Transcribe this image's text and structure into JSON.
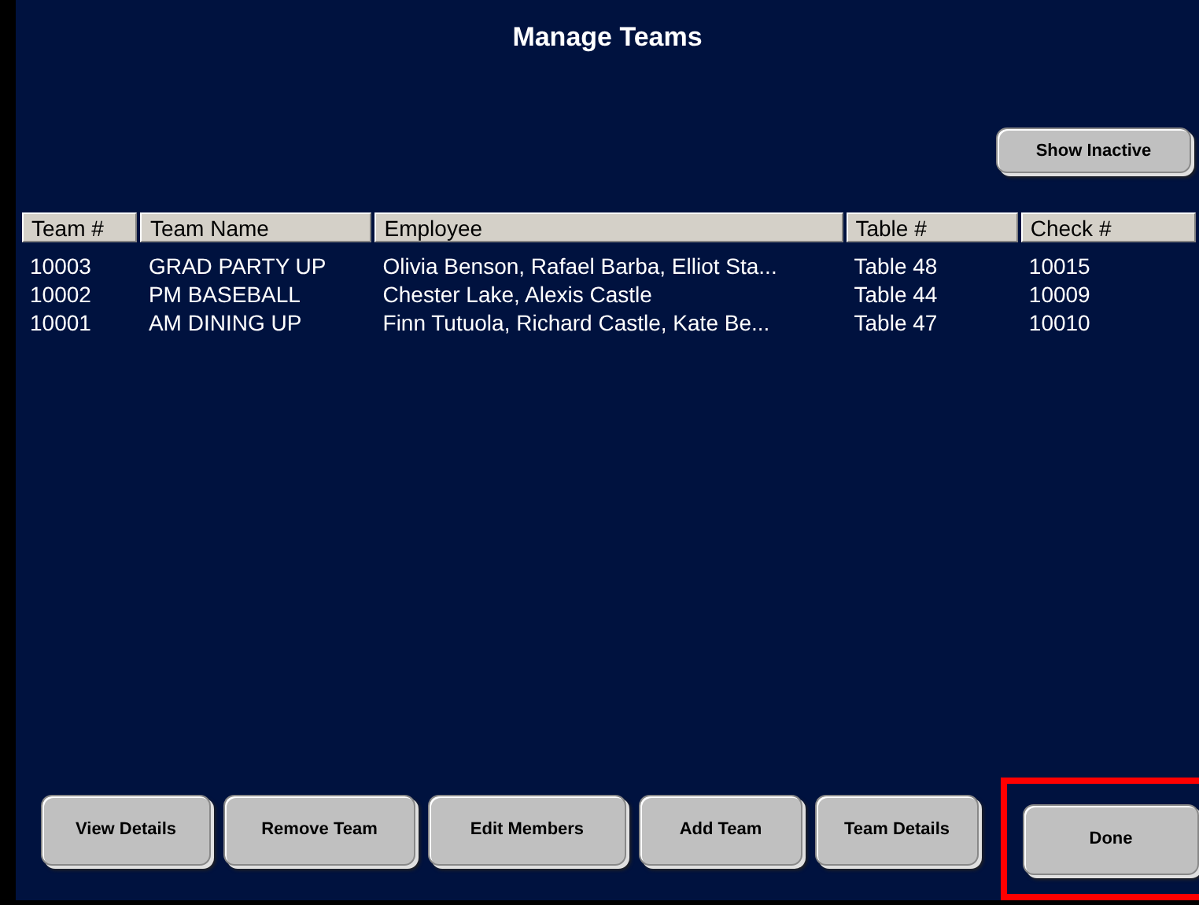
{
  "window": {
    "title": "Manage Teams"
  },
  "show_inactive_button": {
    "label": "Show Inactive"
  },
  "table": {
    "columns": [
      "Team #",
      "Team Name",
      "Employee",
      "Table #",
      "Check #"
    ],
    "rows": [
      [
        "10003",
        "GRAD PARTY UP",
        "Olivia Benson, Rafael Barba, Elliot Sta...",
        "Table 48",
        "10015"
      ],
      [
        "10002",
        "PM BASEBALL",
        "Chester Lake, Alexis Castle",
        "Table 44",
        "10009"
      ],
      [
        "10001",
        "AM DINING UP",
        "Finn Tutuola, Richard Castle, Kate Be...",
        "Table 47",
        "10010"
      ]
    ]
  },
  "buttons": [
    {
      "label": "View Details",
      "highlighted": false
    },
    {
      "label": "Remove Team",
      "highlighted": false
    },
    {
      "label": "Edit Members",
      "highlighted": false
    },
    {
      "label": "Add Team",
      "highlighted": false
    },
    {
      "label": "Team Details",
      "highlighted": false
    },
    {
      "label": "Done",
      "highlighted": true
    }
  ]
}
